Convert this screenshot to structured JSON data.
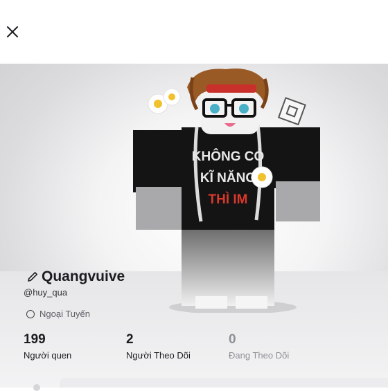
{
  "header": {
    "close_icon": "close-icon"
  },
  "avatar_shirt_text": [
    "KHÔNG CÓ",
    "KĨ NĂNG",
    "THÌ IM"
  ],
  "profile": {
    "display_name": "Quangvuive",
    "username": "@huy_qua",
    "status": "Ngoại Tuyến"
  },
  "stats": [
    {
      "value": "199",
      "label": "Người quen"
    },
    {
      "value": "2",
      "label": "Người Theo Dõi"
    },
    {
      "value": "0",
      "label": "Đang Theo Dõi"
    }
  ],
  "colors": {
    "shirt_black": "#141414",
    "shirt_red_text": "#d9382c",
    "hair": "#9a5a26"
  }
}
